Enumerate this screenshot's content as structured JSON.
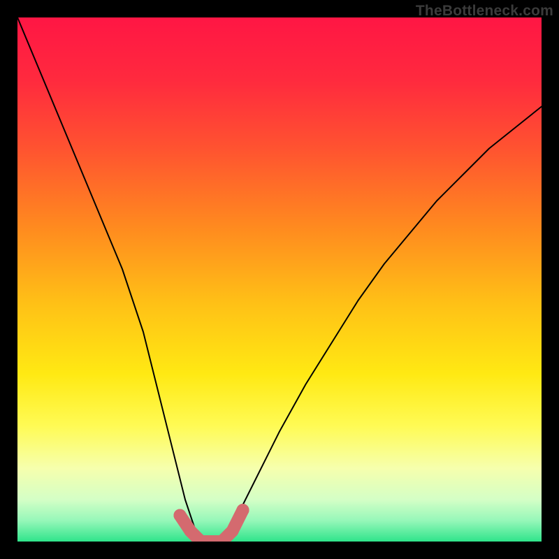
{
  "watermark": "TheBottleneck.com",
  "chart_data": {
    "type": "line",
    "title": "",
    "xlabel": "",
    "ylabel": "",
    "xlim": [
      0,
      100
    ],
    "ylim": [
      0,
      100
    ],
    "series": [
      {
        "name": "bottleneck-curve",
        "x": [
          0,
          5,
          10,
          15,
          20,
          24,
          27,
          30,
          32,
          34,
          36,
          38,
          40,
          43,
          46,
          50,
          55,
          60,
          65,
          70,
          75,
          80,
          85,
          90,
          95,
          100
        ],
        "values": [
          100,
          88,
          76,
          64,
          52,
          40,
          28,
          16,
          8,
          2,
          0,
          0,
          2,
          7,
          13,
          21,
          30,
          38,
          46,
          53,
          59,
          65,
          70,
          75,
          79,
          83
        ]
      }
    ],
    "highlight_band": {
      "name": "ideal-range-marker",
      "x": [
        31,
        33,
        35,
        37,
        39,
        41,
        43
      ],
      "values": [
        5,
        2,
        0,
        0,
        0,
        2,
        6
      ]
    },
    "gradient_stops": [
      {
        "pos": 0.0,
        "color": "#ff1644"
      },
      {
        "pos": 0.12,
        "color": "#ff2a3e"
      },
      {
        "pos": 0.25,
        "color": "#ff5330"
      },
      {
        "pos": 0.4,
        "color": "#ff8a1f"
      },
      {
        "pos": 0.55,
        "color": "#ffc216"
      },
      {
        "pos": 0.68,
        "color": "#ffe913"
      },
      {
        "pos": 0.78,
        "color": "#fffb55"
      },
      {
        "pos": 0.86,
        "color": "#f6ffad"
      },
      {
        "pos": 0.92,
        "color": "#d4ffc6"
      },
      {
        "pos": 0.96,
        "color": "#96f7b9"
      },
      {
        "pos": 1.0,
        "color": "#2fe48b"
      }
    ],
    "highlight_color": "#d46a6f",
    "curve_color": "#000000"
  }
}
